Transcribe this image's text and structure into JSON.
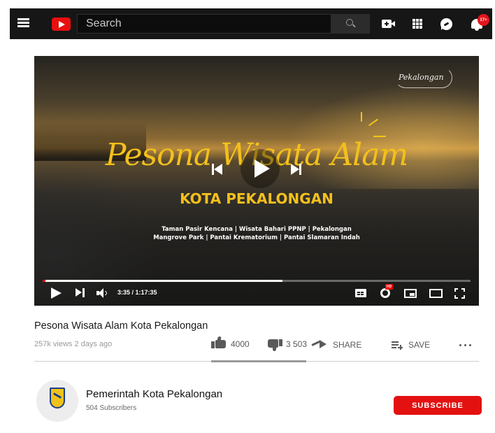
{
  "header": {
    "search_placeholder": "Search",
    "notification_count": "17+"
  },
  "player": {
    "overlay_title": "Pesona Wisata Alam",
    "overlay_subtitle": "KOTA PEKALONGAN",
    "overlay_caption_line1": "Taman Pasir Kencana | Wisata Bahari PPNP | Pekalongan",
    "overlay_caption_line2": "Mangrove Park | Pantai Krematorium | Pantai Slamaran Indah",
    "watermark": "Pekalongan",
    "time_display": "3:35 / 1:17:35",
    "progress_fraction": 0.05,
    "buffer_fraction": 0.56,
    "hd_badge": "HD"
  },
  "video": {
    "title": "Pesona Wisata Alam Kota Pekalongan",
    "meta": "257k views  2 days ago",
    "like_count": "4000",
    "dislike_count": "3 503",
    "share_label": "SHARE",
    "save_label": "SAVE"
  },
  "channel": {
    "name": "Pemerintah Kota Pekalongan",
    "subscribers": "504 Subscribers",
    "subscribe_label": "SUBSCRIBE"
  },
  "colors": {
    "brand_red": "#e41111",
    "overlay_yellow": "#f3c01c",
    "topbar": "#161616"
  },
  "icons": [
    "menu-icon",
    "youtube-logo-icon",
    "search-icon",
    "create-video-icon",
    "apps-icon",
    "chat-icon",
    "bell-icon",
    "play-icon",
    "skip-previous-icon",
    "skip-next-icon",
    "volume-icon",
    "captions-icon",
    "settings-gear-icon",
    "miniplayer-icon",
    "theater-mode-icon",
    "fullscreen-icon",
    "like-icon",
    "dislike-icon",
    "share-icon",
    "save-playlist-icon",
    "more-icon"
  ]
}
